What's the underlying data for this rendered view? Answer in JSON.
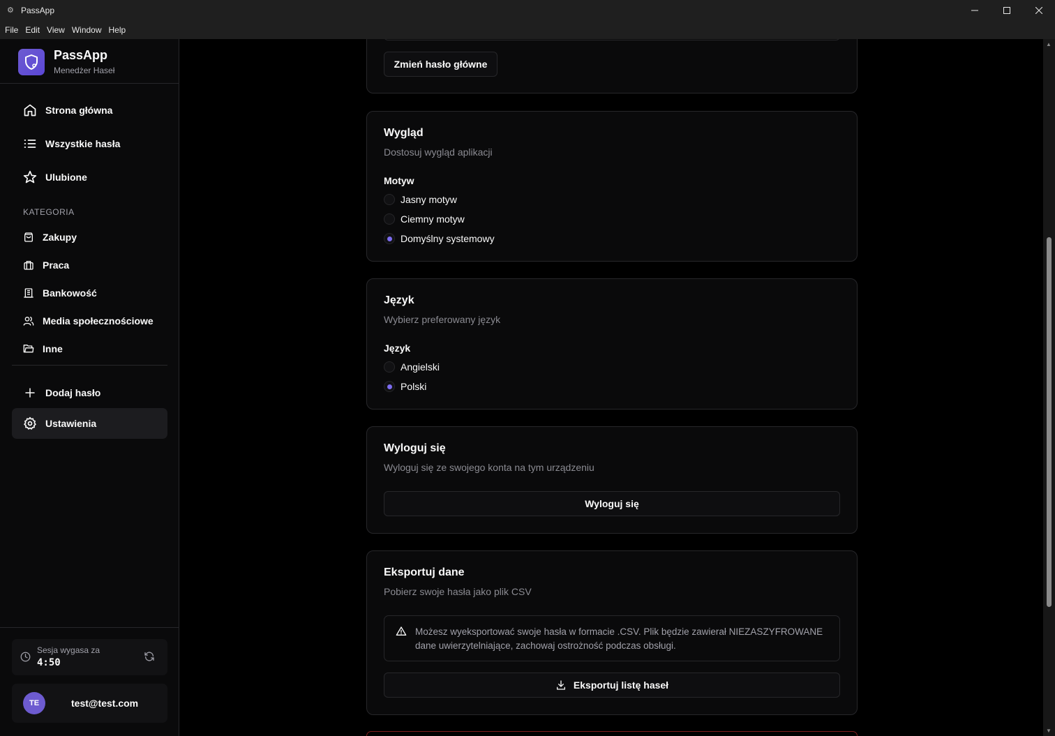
{
  "window": {
    "title": "PassApp"
  },
  "menu": [
    "File",
    "Edit",
    "View",
    "Window",
    "Help"
  ],
  "brand": {
    "name": "PassApp",
    "subtitle": "Menedżer Haseł"
  },
  "nav": [
    {
      "label": "Strona główna",
      "icon": "home-icon"
    },
    {
      "label": "Wszystkie hasła",
      "icon": "list-icon"
    },
    {
      "label": "Ulubione",
      "icon": "star-icon"
    }
  ],
  "category_label": "KATEGORIA",
  "categories": [
    {
      "label": "Zakupy",
      "icon": "shopping-bag-icon"
    },
    {
      "label": "Praca",
      "icon": "briefcase-icon"
    },
    {
      "label": "Bankowość",
      "icon": "bank-icon"
    },
    {
      "label": "Media społecznościowe",
      "icon": "users-icon"
    },
    {
      "label": "Inne",
      "icon": "folder-icon"
    }
  ],
  "actions": [
    {
      "label": "Dodaj hasło",
      "icon": "plus-icon"
    },
    {
      "label": "Ustawienia",
      "icon": "gear-icon",
      "active": true
    }
  ],
  "session": {
    "label": "Sesja wygasa za",
    "time": "4:50"
  },
  "user": {
    "initials": "TE",
    "email": "test@test.com"
  },
  "password_card": {
    "button": "Zmień hasło główne"
  },
  "appearance": {
    "title": "Wygląd",
    "description": "Dostosuj wygląd aplikacji",
    "field_label": "Motyw",
    "options": [
      "Jasny motyw",
      "Ciemny motyw",
      "Domyślny systemowy"
    ],
    "selected": "Domyślny systemowy"
  },
  "language": {
    "title": "Język",
    "description": "Wybierz preferowany język",
    "field_label": "Język",
    "options": [
      "Angielski",
      "Polski"
    ],
    "selected": "Polski"
  },
  "logout": {
    "title": "Wyloguj się",
    "description": "Wyloguj się ze swojego konta na tym urządzeniu",
    "button": "Wyloguj się"
  },
  "export": {
    "title": "Eksportuj dane",
    "description": "Pobierz swoje hasła jako plik CSV",
    "alert": "Możesz wyeksportować swoje hasła w formacie .CSV. Plik będzie zawierał NIEZASZYFROWANE dane uwierzytelniające, zachowaj ostrożność podczas obsługi.",
    "button": "Eksportuj listę haseł"
  },
  "colors": {
    "accent": "#6d5bd0",
    "background": "#000000",
    "card": "#0a0a0b",
    "border": "#27272a"
  }
}
